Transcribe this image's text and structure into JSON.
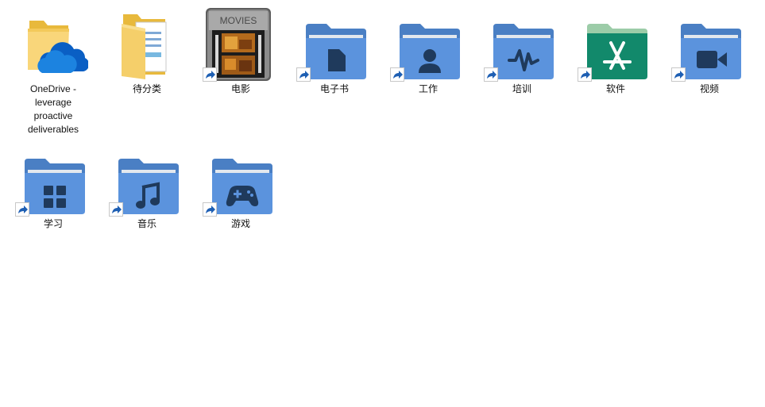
{
  "desktop": {
    "items": [
      {
        "label": "OneDrive - leverage proactive deliverables",
        "icon": "onedrive-folder-icon"
      },
      {
        "label": "待分类",
        "icon": "folder-icon"
      },
      {
        "label": "电影",
        "icon": "movies-icon"
      },
      {
        "label": "电子书",
        "icon": "book-folder-icon"
      },
      {
        "label": "工作",
        "icon": "person-folder-icon"
      },
      {
        "label": "培训",
        "icon": "waveform-folder-icon"
      },
      {
        "label": "软件",
        "icon": "appstore-folder-icon"
      },
      {
        "label": "视频",
        "icon": "video-folder-icon"
      },
      {
        "label": "学习",
        "icon": "grid-folder-icon"
      },
      {
        "label": "音乐",
        "icon": "music-folder-icon"
      },
      {
        "label": "游戏",
        "icon": "gamepad-folder-icon"
      }
    ],
    "movies_icon_text": "MOVIES"
  },
  "colors": {
    "folder_blue_back": "#4a7fc4",
    "folder_blue_front": "#5b93dd",
    "folder_paper": "#e3e8ee",
    "glyph_dark": "#1f3a5c",
    "folder_green_back": "#9ccca8",
    "folder_green_front": "#12896b",
    "shortcut_arrow": "#1e5fb3"
  }
}
